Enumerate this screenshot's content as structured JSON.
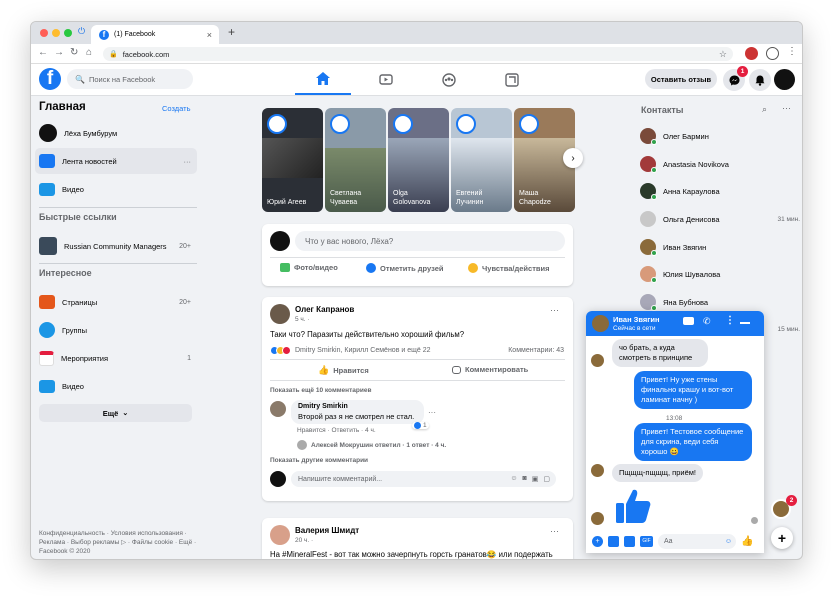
{
  "browser": {
    "tab_title": "(1) Facebook",
    "new_tab": "+",
    "tab_close": "×",
    "url": "facebook.com"
  },
  "header": {
    "search_placeholder": "Поиск на Facebook",
    "feedback_label": "Оставить отзыв",
    "notif_count": "1"
  },
  "sidebar": {
    "title": "Главная",
    "create_link": "Создать",
    "items": [
      {
        "label": "Лёха Бумбурум"
      },
      {
        "label": "Лента новостей"
      },
      {
        "label": "Видео"
      }
    ],
    "shortcuts_title": "Быстрые ссылки",
    "shortcuts": [
      {
        "label": "Russian Community Managers",
        "count": "20+"
      }
    ],
    "explore_title": "Интересное",
    "explore": [
      {
        "label": "Страницы",
        "count": "20+"
      },
      {
        "label": "Группы",
        "count": ""
      },
      {
        "label": "Мероприятия",
        "count": "1"
      },
      {
        "label": "Видео",
        "count": ""
      }
    ],
    "more_label": "Ещё",
    "footer": "Конфиденциальность · Условия использования · Реклама · Выбор рекламы ▷ · Файлы cookie · Ещё · Facebook © 2020"
  },
  "stories": [
    {
      "name": "Юрий Агеев",
      "bg": "#2b2f36"
    },
    {
      "name": "Светлана Чуваева",
      "bg": "#8a9aa8"
    },
    {
      "name": "Olga Golovanova",
      "bg": "#6b6f86"
    },
    {
      "name": "Евгений Лучинин",
      "bg": "#b8c6d4"
    },
    {
      "name": "Маша Chapodze",
      "bg": "#9a7a5a"
    }
  ],
  "composer": {
    "placeholder": "Что у вас нового, Лёха?",
    "photo": "Фото/видео",
    "tag": "Отметить друзей",
    "feeling": "Чувства/действия"
  },
  "post1": {
    "author": "Олег Капранов",
    "time": "5 ч. ·",
    "text": "Таки что? Паразиты действительно хороший фильм?",
    "reactions": "Dmitry Smirkin, Кирилл Семёнов и ещё 22",
    "comments_count": "Комментарии: 43",
    "like": "Нравится",
    "comment": "Комментировать",
    "show_prev": "Показать ещё 10 комментариев",
    "c_author": "Dmitry Smirkin",
    "c_text": "Второй раз я не смотрел не стал.",
    "c_actions": "Нравится · Ответить · 4 ч.",
    "c_like_count": "1",
    "reply": "Алексей Мокрушин ответил · 1 ответ · 4 ч.",
    "show_other": "Показать другие комментарии",
    "write_placeholder": "Напишите комментарий..."
  },
  "post2": {
    "author": "Валерия Шмидт",
    "time": "20 ч. ·",
    "text": "На #MineralFest - вот так можно зачерпнуть горсть гранатов😂 или подержать"
  },
  "contacts": {
    "title": "Контакты",
    "items": [
      {
        "name": "Олег Бармин",
        "time": "",
        "color": "#7a4a3a"
      },
      {
        "name": "Anastasia Novikova",
        "time": "",
        "color": "#a23a3a"
      },
      {
        "name": "Анна Караулова",
        "time": "",
        "color": "#2a3a2a"
      },
      {
        "name": "Ольга Денисова",
        "time": "31 мин.",
        "color": "#c8c8c8"
      },
      {
        "name": "Иван Звягин",
        "time": "",
        "color": "#8a6a3a"
      },
      {
        "name": "Юлия Шувалова",
        "time": "",
        "color": "#d89a7a"
      },
      {
        "name": "Яна Бубнова",
        "time": "",
        "color": "#a8a8b8"
      },
      {
        "name": "",
        "time": "15 мин.",
        "color": "#6a6a6a"
      }
    ]
  },
  "chat": {
    "name": "Иван Звягин",
    "status": "Сейчас в сети",
    "msg1": "чо брать, а куда смотреть в принципе",
    "msg2": "Привет! Ну уже стены финально крашу и вот-вот ламинат начну )",
    "time": "13:08",
    "msg3": "Привет! Тестовое сообщение для скрина, веди себя хорошо 😀",
    "msg4": "Пщщщ-пщщщ, приём!",
    "input_placeholder": "Aa",
    "badge": "2"
  }
}
